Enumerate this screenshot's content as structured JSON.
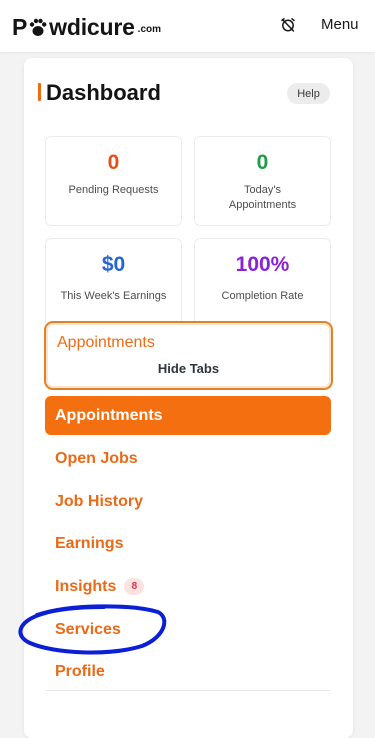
{
  "header": {
    "logo": {
      "lead": "P",
      "rest": "wdicure",
      "suffix": ".com"
    },
    "alarm_icon": "alarm-off-icon",
    "menu_label": "Menu"
  },
  "dashboard": {
    "title": "Dashboard",
    "help_label": "Help",
    "accent_color": "#f26a12",
    "stats": [
      {
        "value": "0",
        "label": "Pending Requests",
        "color": "#e2531a"
      },
      {
        "value": "0",
        "label": "Today's Appointments",
        "color": "#1f9b4a"
      },
      {
        "value": "$0",
        "label": "This Week's Earnings",
        "color": "#2563d6"
      },
      {
        "value": "100%",
        "label": "Completion Rate",
        "color": "#8a22d6"
      }
    ],
    "tab_dropdown": {
      "current": "Appointments",
      "toggle_label": "Hide Tabs"
    },
    "nav": [
      {
        "label": "Appointments",
        "active": true
      },
      {
        "label": "Open Jobs",
        "active": false
      },
      {
        "label": "Job History",
        "active": false
      },
      {
        "label": "Earnings",
        "active": false
      },
      {
        "label": "Insights",
        "active": false,
        "badge": "8"
      },
      {
        "label": "Services",
        "active": false
      },
      {
        "label": "Profile",
        "active": false
      }
    ]
  },
  "annotation": {
    "color": "#0a1fd6"
  }
}
